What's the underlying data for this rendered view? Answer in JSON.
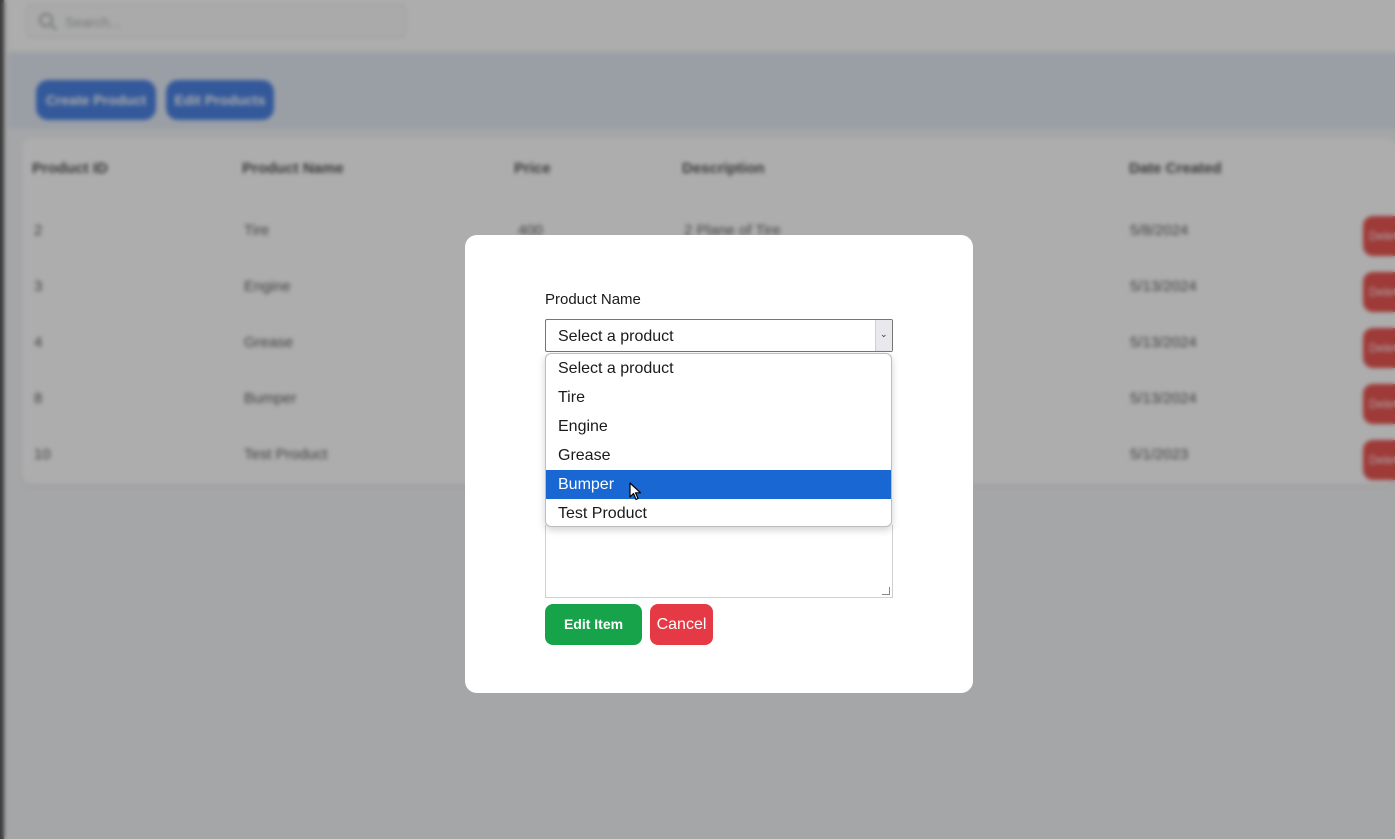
{
  "background": {
    "search": {
      "placeholder": "Search..."
    },
    "actions": {
      "create_label": "Create Product",
      "edit_label": "Edit Products"
    },
    "table": {
      "headers": [
        "Product ID",
        "Product Name",
        "Price",
        "Description",
        "Date Created"
      ],
      "rows": [
        {
          "id": "2",
          "name": "Tire",
          "price": "400",
          "description": "2 Plane of Tire",
          "date": "5/8/2024",
          "action": "Delete"
        },
        {
          "id": "3",
          "name": "Engine",
          "price": "",
          "description": "",
          "date": "5/13/2024",
          "action": "Delete"
        },
        {
          "id": "4",
          "name": "Grease",
          "price": "",
          "description": "",
          "date": "5/13/2024",
          "action": "Delete"
        },
        {
          "id": "8",
          "name": "Bumper",
          "price": "",
          "description": "",
          "date": "5/13/2024",
          "action": "Delete"
        },
        {
          "id": "10",
          "name": "Test Product",
          "price": "",
          "description": "",
          "date": "5/1/2023",
          "action": "Delete"
        }
      ]
    }
  },
  "modal": {
    "product_name_label": "Product Name",
    "select": {
      "value": "Select a product",
      "arrow": "⌄"
    },
    "options": [
      "Select a product",
      "Tire",
      "Engine",
      "Grease",
      "Bumper",
      "Test Product"
    ],
    "highlighted_option": "Bumper",
    "edit_button_label": "Edit Item",
    "cancel_button_label": "Cancel"
  },
  "colors": {
    "primary_blue": "#2f6fe0",
    "highlight_blue": "#1967d2",
    "success_green": "#17a34a",
    "danger_red": "#e53946"
  }
}
